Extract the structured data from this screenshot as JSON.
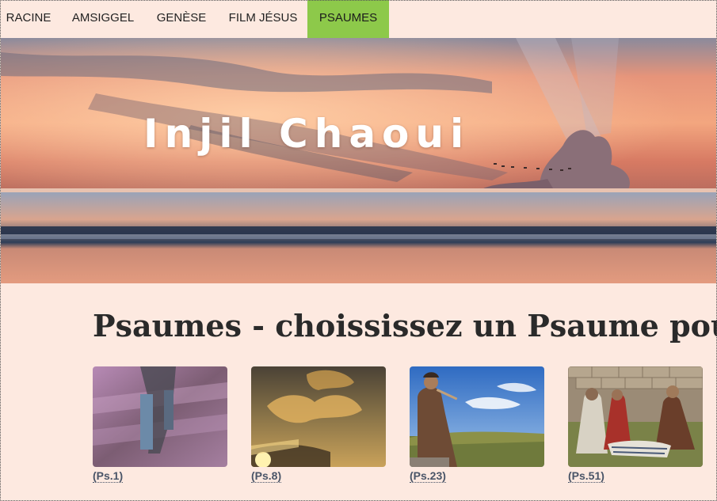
{
  "nav": {
    "items": [
      {
        "label": "RACINE",
        "active": false
      },
      {
        "label": "AMSIGGEL",
        "active": false
      },
      {
        "label": "GENÈSE",
        "active": false
      },
      {
        "label": "FILM JÉSUS",
        "active": false
      },
      {
        "label": "PSAUMES",
        "active": true
      }
    ],
    "active_color": "#8dc94a"
  },
  "hero": {
    "title": "Injil Chaoui",
    "image": "sunset-beach-image"
  },
  "main": {
    "title": "Psaumes - choississez un Psaume pour en v",
    "cards": [
      {
        "caption": "(Ps.1)",
        "image": "lavender-field-walking-image"
      },
      {
        "caption": "(Ps.8)",
        "image": "golden-clouds-sky-image"
      },
      {
        "caption": "(Ps.23)",
        "image": "shepherd-playing-flute-image"
      },
      {
        "caption": "(Ps.51)",
        "image": "people-sitting-outdoors-image"
      }
    ]
  },
  "colors": {
    "background": "#fde9e0",
    "text": "#2a2a2a",
    "caption": "#4a5568"
  }
}
